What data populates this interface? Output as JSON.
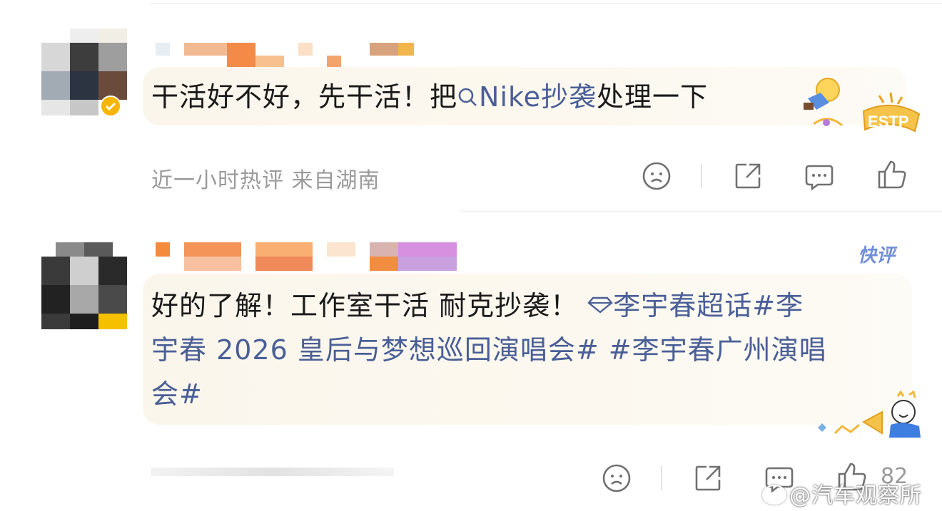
{
  "comments": [
    {
      "text_plain": "干活好不好，先干活！把",
      "search_link": "Nike抄袭",
      "text_after": "处理一下",
      "badge": "ESTP",
      "meta": "近一小时热评  来自湖南"
    },
    {
      "badge_fast": "快评",
      "text_plain": "好的了解！工作室干活 耐克抄袭！",
      "topic_link": "李宇春超话",
      "hashtag_1_line1": "#李",
      "hashtag_1_line2": "宇春 2026 皇后与梦想巡回演唱会#",
      "hashtag_2_line2": " #李宇春广州演唱",
      "hashtag_2_line3": "会#",
      "like_count": "82"
    }
  ],
  "watermark": "@汽车观察所",
  "icons": [
    "sad-face-icon",
    "share-icon",
    "comment-icon",
    "like-icon",
    "search-icon",
    "diamond-icon"
  ]
}
